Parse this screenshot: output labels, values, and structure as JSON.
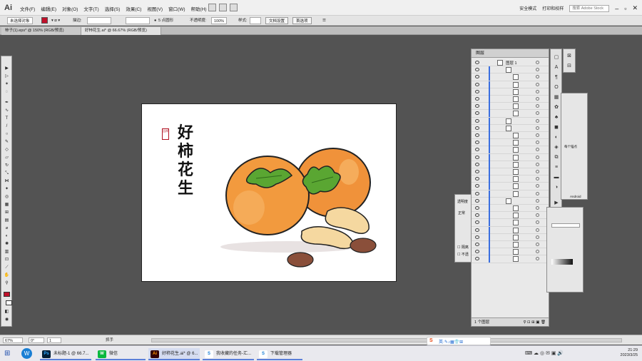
{
  "menubar": {
    "logo": "Ai",
    "items": [
      "文件(F)",
      "编辑(E)",
      "对象(O)",
      "文字(T)",
      "选择(S)",
      "效果(C)",
      "视图(V)",
      "窗口(W)",
      "帮助(H)"
    ],
    "workspace_mode": "安全模式",
    "print_preview": "打印和校样",
    "search_placeholder": "搜索 Adobe Stock"
  },
  "control_bar": {
    "selection": "未选择对象",
    "stroke_label": "描边:",
    "brush": "5 点圆形",
    "opacity_label": "不透明度:",
    "opacity_value": "100%",
    "style_label": "样式:",
    "doc_setup": "文档设置",
    "preferences": "首选项"
  },
  "doc_tabs": [
    {
      "label": "柿子(1).eps* @ 150% (RGB/预览)",
      "active": false
    },
    {
      "label": "好柿花生.ai* @ 66.67% (RGB/预览)",
      "active": true
    }
  ],
  "artwork": {
    "title_chars": [
      "好",
      "柿",
      "花",
      "生"
    ],
    "seal_text": "吉祥"
  },
  "layers_panel": {
    "title": "图层",
    "top_layer": "图层 1",
    "footer": "1 个图层"
  },
  "transparency_panel": {
    "title": "透明度",
    "mode": "正常",
    "option1": "隔离",
    "option2": "不透"
  },
  "right_panel": {
    "label": "每个锚点",
    "android": "Android"
  },
  "status_bar": {
    "zoom": "67%",
    "angle": "0°",
    "artboard": "1",
    "tool": "抓手"
  },
  "taskbar": {
    "items": [
      {
        "label": "未标题-1 @ 66.7...",
        "icon": "Ps"
      },
      {
        "label": "微信",
        "icon": "W"
      },
      {
        "label": "好柿花生.ai* @ 6...",
        "icon": "Ai"
      },
      {
        "label": "我收藏的任务-汇...",
        "icon": "S"
      },
      {
        "label": "下载管理器",
        "icon": "S"
      }
    ],
    "time": "21:29",
    "date": "2023/3/25"
  }
}
